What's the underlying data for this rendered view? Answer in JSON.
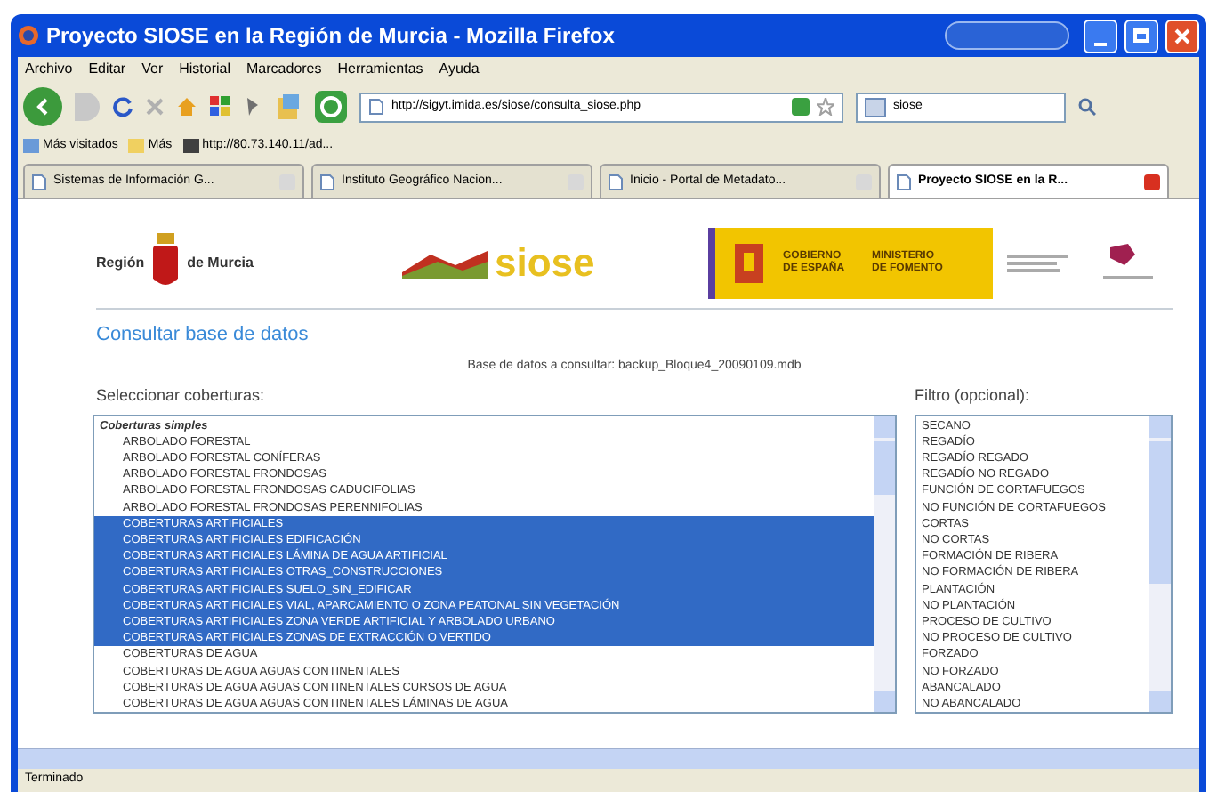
{
  "window": {
    "title": "Proyecto SIOSE en la Región de Murcia - Mozilla Firefox"
  },
  "menu": [
    "Archivo",
    "Editar",
    "Ver",
    "Historial",
    "Marcadores",
    "Herramientas",
    "Ayuda"
  ],
  "address": {
    "value": "http://sigyt.imida.es/siose/consulta_siose.php"
  },
  "search": {
    "value": "siose"
  },
  "bookmarks": [
    "Más visitados",
    "Más",
    "http://80.73.140.11/ad..."
  ],
  "tabs": [
    {
      "label": "Sistemas de Información G...",
      "selected": false
    },
    {
      "label": "Instituto Geográfico Nacion...",
      "selected": false
    },
    {
      "label": "Inicio - Portal de Metadato...",
      "selected": false
    },
    {
      "label": "Proyecto SIOSE en la R...",
      "selected": true
    }
  ],
  "header": {
    "region_left": "Región",
    "region_right": "de Murcia",
    "siose": "siose",
    "gobierno": "GOBIERNO DE ESPAÑA",
    "ministerio": "MINISTERIO DE FOMENTO"
  },
  "page": {
    "heading": "Consultar base de datos",
    "database": "Base de datos a consultar: backup_Bloque4_20090109.mdb",
    "coverages_label": "Seleccionar coberturas:",
    "filter_label": "Filtro (opcional):"
  },
  "coverages": [
    {
      "kind": "group",
      "label": "Coberturas simples",
      "selected": false
    },
    {
      "kind": "item",
      "label": "ARBOLADO FORESTAL",
      "selected": false
    },
    {
      "kind": "item",
      "label": "ARBOLADO FORESTAL CONÍFERAS",
      "selected": false
    },
    {
      "kind": "item",
      "label": "ARBOLADO FORESTAL FRONDOSAS",
      "selected": false
    },
    {
      "kind": "item",
      "label": "ARBOLADO FORESTAL FRONDOSAS CADUCIFOLIAS",
      "selected": false
    },
    {
      "kind": "item",
      "label": "ARBOLADO FORESTAL FRONDOSAS PERENNIFOLIAS",
      "selected": false
    },
    {
      "kind": "item",
      "label": "COBERTURAS ARTIFICIALES",
      "selected": true
    },
    {
      "kind": "item",
      "label": "COBERTURAS ARTIFICIALES EDIFICACIÓN",
      "selected": true
    },
    {
      "kind": "item",
      "label": "COBERTURAS ARTIFICIALES LÁMINA DE AGUA ARTIFICIAL",
      "selected": true
    },
    {
      "kind": "item",
      "label": "COBERTURAS ARTIFICIALES OTRAS_CONSTRUCCIONES",
      "selected": true
    },
    {
      "kind": "item",
      "label": "COBERTURAS ARTIFICIALES SUELO_SIN_EDIFICAR",
      "selected": true
    },
    {
      "kind": "item",
      "label": "COBERTURAS ARTIFICIALES VIAL, APARCAMIENTO O ZONA PEATONAL SIN VEGETACIÓN",
      "selected": true
    },
    {
      "kind": "item",
      "label": "COBERTURAS ARTIFICIALES ZONA VERDE ARTIFICIAL Y ARBOLADO URBANO",
      "selected": true
    },
    {
      "kind": "item",
      "label": "COBERTURAS ARTIFICIALES ZONAS DE EXTRACCIÓN O VERTIDO",
      "selected": true
    },
    {
      "kind": "item",
      "label": "COBERTURAS DE AGUA",
      "selected": false
    },
    {
      "kind": "item",
      "label": "COBERTURAS DE AGUA AGUAS CONTINENTALES",
      "selected": false
    },
    {
      "kind": "item",
      "label": "COBERTURAS DE AGUA AGUAS CONTINENTALES CURSOS DE AGUA",
      "selected": false
    },
    {
      "kind": "item",
      "label": "COBERTURAS DE AGUA AGUAS CONTINENTALES LÁMINAS DE AGUA",
      "selected": false
    }
  ],
  "filters": [
    {
      "label": "SECANO",
      "selected": false
    },
    {
      "label": "REGADÍO",
      "selected": false
    },
    {
      "label": "REGADÍO REGADO",
      "selected": false
    },
    {
      "label": "REGADÍO NO REGADO",
      "selected": false
    },
    {
      "label": "FUNCIÓN DE CORTAFUEGOS",
      "selected": false
    },
    {
      "label": "NO FUNCIÓN DE CORTAFUEGOS",
      "selected": false
    },
    {
      "label": "CORTAS",
      "selected": false
    },
    {
      "label": "NO CORTAS",
      "selected": false
    },
    {
      "label": "FORMACIÓN DE RIBERA",
      "selected": false
    },
    {
      "label": "NO FORMACIÓN DE RIBERA",
      "selected": false
    },
    {
      "label": "PLANTACIÓN",
      "selected": false
    },
    {
      "label": "NO PLANTACIÓN",
      "selected": false
    },
    {
      "label": "PROCESO DE CULTIVO",
      "selected": false
    },
    {
      "label": "NO PROCESO DE CULTIVO",
      "selected": false
    },
    {
      "label": "FORZADO",
      "selected": false
    },
    {
      "label": "NO FORZADO",
      "selected": false
    },
    {
      "label": "ABANCALADO",
      "selected": false
    },
    {
      "label": "NO ABANCALADO",
      "selected": false
    }
  ],
  "status_bar": {
    "text": "Terminado"
  }
}
